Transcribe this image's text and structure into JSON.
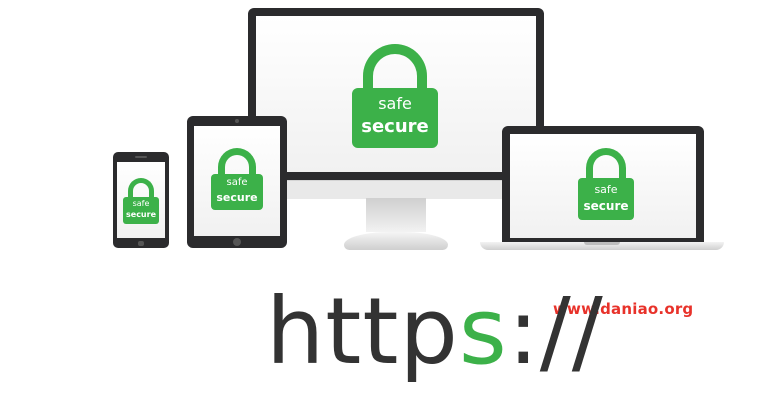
{
  "devices": {
    "monitor": {
      "lock": {
        "top": "safe",
        "bottom": "secure"
      }
    },
    "tablet": {
      "lock": {
        "top": "safe",
        "bottom": "secure"
      }
    },
    "phone": {
      "lock": {
        "top": "safe",
        "bottom": "secure"
      }
    },
    "laptop": {
      "lock": {
        "top": "safe",
        "bottom": "secure"
      }
    }
  },
  "watermark": {
    "url": "www.daniao.org"
  },
  "headline": {
    "main": "http",
    "accent": "s",
    "suffix": "://"
  },
  "colors": {
    "accent_green": "#3cb149",
    "watermark_red": "#e8322a",
    "text_dark": "#333333",
    "device_bezel": "#2b2b2d"
  }
}
